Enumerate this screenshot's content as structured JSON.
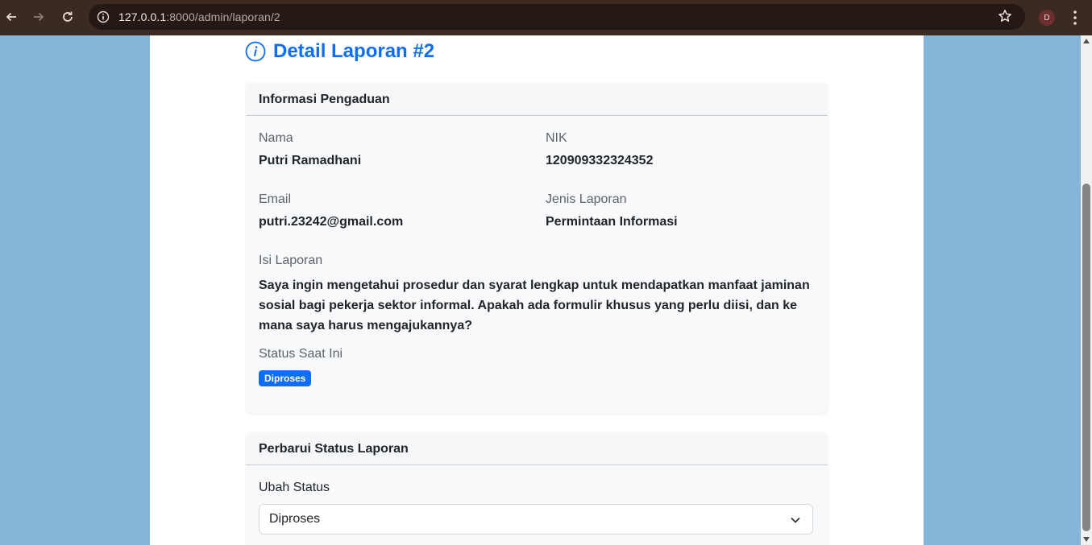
{
  "browser": {
    "url_host": "127.0.0.1",
    "url_rest": ":8000/admin/laporan/2",
    "profile_initial": "D"
  },
  "page": {
    "title": "Detail Laporan #2",
    "accent_color": "#0d6efd"
  },
  "info_card": {
    "header": "Informasi Pengaduan",
    "nama_label": "Nama",
    "nama_value": "Putri Ramadhani",
    "nik_label": "NIK",
    "nik_value": "120909332324352",
    "email_label": "Email",
    "email_value": "putri.23242@gmail.com",
    "jenis_label": "Jenis Laporan",
    "jenis_value": "Permintaan Informasi",
    "isi_label": "Isi Laporan",
    "isi_value": "Saya ingin mengetahui prosedur dan syarat lengkap untuk mendapatkan manfaat jaminan sosial bagi pekerja sektor informal. Apakah ada formulir khusus yang perlu diisi, dan ke mana saya harus mengajukannya?",
    "status_label": "Status Saat Ini",
    "status_badge": "Diproses"
  },
  "update_card": {
    "header": "Perbarui Status Laporan",
    "select_label": "Ubah Status",
    "select_value": "Diproses"
  },
  "icons": {
    "title": "info-circle-icon",
    "select": "chevron-down-icon"
  }
}
